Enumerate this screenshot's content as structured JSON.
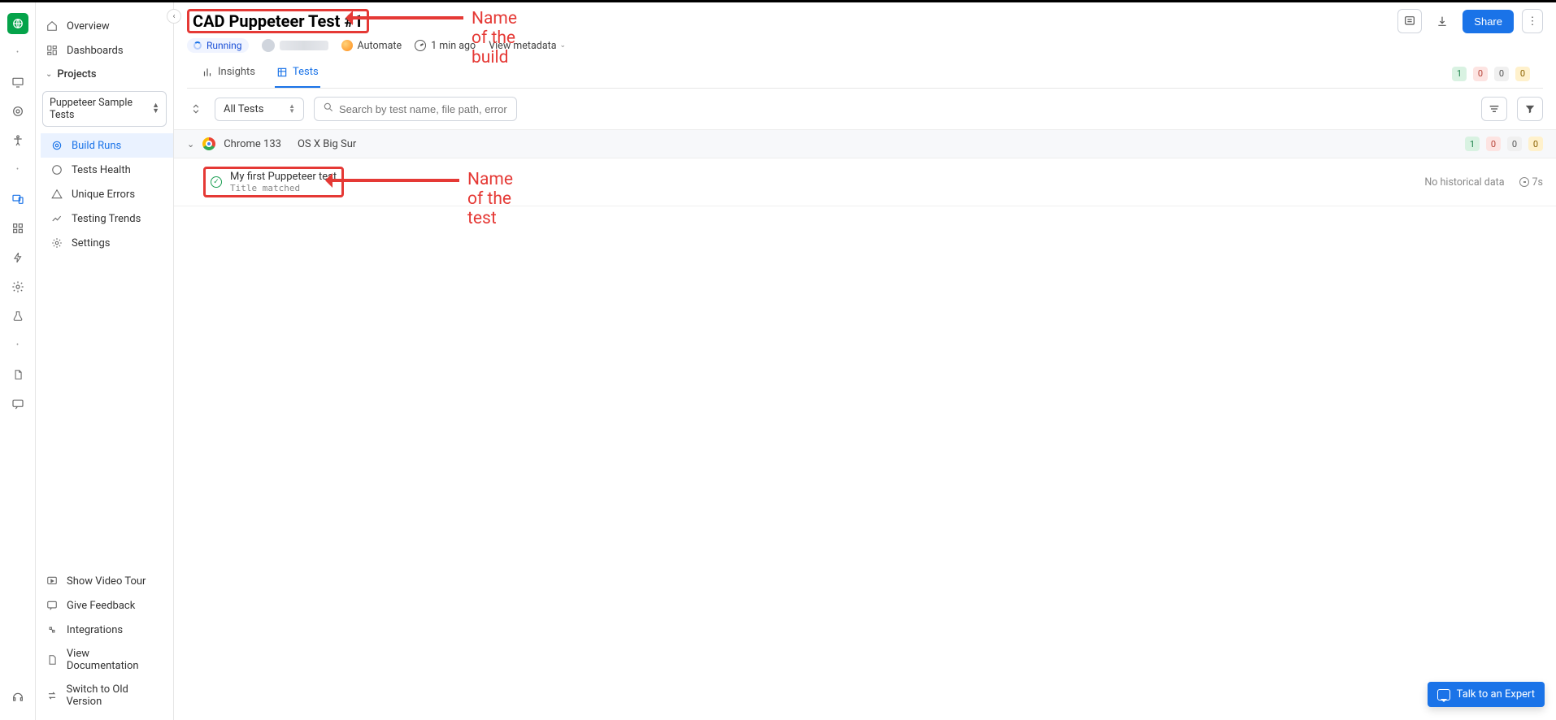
{
  "iconRail": {
    "top": [
      "logo",
      "dot",
      "monitor",
      "target",
      "accessibility",
      "dot",
      "device",
      "grid",
      "bolt",
      "gear",
      "beaker",
      "dot",
      "doc",
      "feedback"
    ],
    "bottom": [
      "help"
    ]
  },
  "sidebar": {
    "main": [
      {
        "label": "Overview"
      },
      {
        "label": "Dashboards"
      }
    ],
    "projects_header": "Projects",
    "project_select_value": "Puppeteer Sample Tests",
    "project_items": [
      {
        "label": "Build Runs",
        "active": true
      },
      {
        "label": "Tests Health"
      },
      {
        "label": "Unique Errors"
      },
      {
        "label": "Testing Trends"
      },
      {
        "label": "Settings"
      }
    ],
    "bottom": [
      {
        "label": "Show Video Tour"
      },
      {
        "label": "Give Feedback"
      },
      {
        "label": "Integrations"
      },
      {
        "label": "View Documentation"
      },
      {
        "label": "Switch to Old Version"
      }
    ]
  },
  "header": {
    "build_name": "CAD Puppeteer Test #1",
    "status": "Running",
    "product": "Automate",
    "time_ago": "1 min ago",
    "view_metadata": "View metadata",
    "share": "Share"
  },
  "annotations": {
    "build_label": "Name of the build",
    "test_label": "Name of the test"
  },
  "tabs": {
    "insights": "Insights",
    "tests": "Tests"
  },
  "counts": {
    "passed": "1",
    "failed": "0",
    "skipped": "0",
    "pending": "0"
  },
  "filters": {
    "all_tests": "All Tests",
    "search_placeholder": "Search by test name, file path, error or BrowserSt"
  },
  "group": {
    "browser": "Chrome 133",
    "os": "OS X Big Sur",
    "counts": {
      "passed": "1",
      "failed": "0",
      "skipped": "0",
      "pending": "0"
    }
  },
  "test": {
    "name": "My first Puppeteer test",
    "subtitle": "Title matched",
    "history": "No historical data",
    "duration": "7s"
  },
  "chat": {
    "label": "Talk to an Expert"
  }
}
